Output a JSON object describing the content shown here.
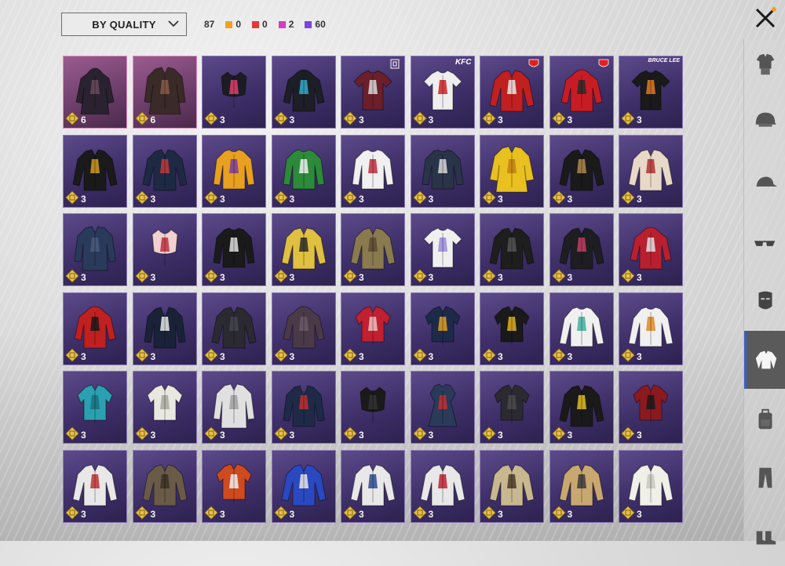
{
  "header": {
    "sort_label": "BY QUALITY",
    "total": "87",
    "stats": [
      {
        "color": "#f0a020",
        "value": "0"
      },
      {
        "color": "#e03a3a",
        "value": "0"
      },
      {
        "color": "#d33cc0",
        "value": "2"
      },
      {
        "color": "#7a44e0",
        "value": "60"
      }
    ]
  },
  "close_icon": "close-icon",
  "items": [
    {
      "count": "6",
      "tier": "pink",
      "art": "hooded-long-coat",
      "c1": "#2a2230",
      "c2": "#6a4a5a"
    },
    {
      "count": "6",
      "tier": "pink",
      "art": "trench-coat",
      "c1": "#3a2a28",
      "c2": "#8a5a4a"
    },
    {
      "count": "3",
      "tier": "purple",
      "art": "crop-top",
      "c1": "#1c1c24",
      "c2": "#e04070"
    },
    {
      "count": "3",
      "tier": "purple",
      "art": "hoodie",
      "c1": "#1e1e26",
      "c2": "#33aacc"
    },
    {
      "count": "3",
      "tier": "purple",
      "art": "tshirt",
      "c1": "#6a1f2a",
      "c2": "#d8d8d8",
      "brand_logo": "box"
    },
    {
      "count": "3",
      "tier": "purple",
      "art": "tshirt",
      "c1": "#eeeeee",
      "c2": "#d02020",
      "brand": "KFC"
    },
    {
      "count": "3",
      "tier": "purple",
      "art": "jacket",
      "c1": "#c02020",
      "c2": "#e8e8e8",
      "brand_logo": "shield"
    },
    {
      "count": "3",
      "tier": "purple",
      "art": "hoodie",
      "c1": "#c81c24",
      "c2": "#2a2a2a",
      "brand_logo": "shield"
    },
    {
      "count": "3",
      "tier": "purple",
      "art": "tshirt",
      "c1": "#1a1a1a",
      "c2": "#e07a20",
      "brand": "BRUCE LEE"
    },
    {
      "count": "3",
      "tier": "purple",
      "art": "jacket",
      "c1": "#1a1a1a",
      "c2": "#d09a20"
    },
    {
      "count": "3",
      "tier": "purple",
      "art": "jacket",
      "c1": "#1e2a44",
      "c2": "#c03a3a"
    },
    {
      "count": "3",
      "tier": "purple",
      "art": "sweater",
      "c1": "#e8a020",
      "c2": "#7a3aa0"
    },
    {
      "count": "3",
      "tier": "purple",
      "art": "sweater",
      "c1": "#2c8a3a",
      "c2": "#f0f0f0"
    },
    {
      "count": "3",
      "tier": "purple",
      "art": "sweater",
      "c1": "#f0f0f0",
      "c2": "#c02a3a"
    },
    {
      "count": "3",
      "tier": "purple",
      "art": "sweater",
      "c1": "#2a3448",
      "c2": "#d8d8d8"
    },
    {
      "count": "3",
      "tier": "purple",
      "art": "robe",
      "c1": "#e8c020",
      "c2": "#c08010"
    },
    {
      "count": "3",
      "tier": "purple",
      "art": "jacket",
      "c1": "#1a1a1a",
      "c2": "#b08a50"
    },
    {
      "count": "3",
      "tier": "purple",
      "art": "jacket",
      "c1": "#e8d8c8",
      "c2": "#b03030"
    },
    {
      "count": "3",
      "tier": "purple",
      "art": "coat",
      "c1": "#2a3a5a",
      "c2": "#4a5a7a"
    },
    {
      "count": "3",
      "tier": "purple",
      "art": "crop-top",
      "c1": "#f0d0d0",
      "c2": "#c03040"
    },
    {
      "count": "3",
      "tier": "purple",
      "art": "sweater",
      "c1": "#1a1a1a",
      "c2": "#e0e0e0"
    },
    {
      "count": "3",
      "tier": "purple",
      "art": "jacket",
      "c1": "#e0c040",
      "c2": "#2a2a2a"
    },
    {
      "count": "3",
      "tier": "purple",
      "art": "jacket",
      "c1": "#8a7a50",
      "c2": "#5a4a30"
    },
    {
      "count": "3",
      "tier": "purple",
      "art": "tshirt",
      "c1": "#f0f0f0",
      "c2": "#9a8ae0"
    },
    {
      "count": "3",
      "tier": "purple",
      "art": "jacket",
      "c1": "#1e1e1e",
      "c2": "#555555"
    },
    {
      "count": "3",
      "tier": "purple",
      "art": "jacket",
      "c1": "#1e1e22",
      "c2": "#c04060"
    },
    {
      "count": "3",
      "tier": "purple",
      "art": "hoodie",
      "c1": "#b82030",
      "c2": "#e0e0e0"
    },
    {
      "count": "3",
      "tier": "purple",
      "art": "hoodie",
      "c1": "#c02020",
      "c2": "#1a1a1a"
    },
    {
      "count": "3",
      "tier": "purple",
      "art": "blazer",
      "c1": "#1a2238",
      "c2": "#e8e8e8"
    },
    {
      "count": "3",
      "tier": "purple",
      "art": "jacket",
      "c1": "#2a2a30",
      "c2": "#444450"
    },
    {
      "count": "3",
      "tier": "purple",
      "art": "hoodie",
      "c1": "#4a3a48",
      "c2": "#6a5a68"
    },
    {
      "count": "3",
      "tier": "purple",
      "art": "shirt",
      "c1": "#c02030",
      "c2": "#f0c0c0"
    },
    {
      "count": "3",
      "tier": "purple",
      "art": "shirt",
      "c1": "#1e2a4a",
      "c2": "#e0a020"
    },
    {
      "count": "3",
      "tier": "purple",
      "art": "shirt",
      "c1": "#1a1a1a",
      "c2": "#e0b020"
    },
    {
      "count": "3",
      "tier": "purple",
      "art": "longsleeve",
      "c1": "#f0f0f0",
      "c2": "#40b0a0"
    },
    {
      "count": "3",
      "tier": "purple",
      "art": "longsleeve",
      "c1": "#f0f0f0",
      "c2": "#e08a20"
    },
    {
      "count": "3",
      "tier": "purple",
      "art": "shirt",
      "c1": "#2aa0b0",
      "c2": "#1a7080"
    },
    {
      "count": "3",
      "tier": "purple",
      "art": "shirt",
      "c1": "#e8e8e0",
      "c2": "#a8a8a0"
    },
    {
      "count": "3",
      "tier": "purple",
      "art": "coat",
      "c1": "#e0e0e0",
      "c2": "#a0a0a0"
    },
    {
      "count": "3",
      "tier": "purple",
      "art": "blazer",
      "c1": "#1e2a48",
      "c2": "#c03030"
    },
    {
      "count": "3",
      "tier": "purple",
      "art": "crop-top",
      "c1": "#1a1a1a",
      "c2": "#333333"
    },
    {
      "count": "3",
      "tier": "purple",
      "art": "dress",
      "c1": "#2a3a5a",
      "c2": "#c03030"
    },
    {
      "count": "3",
      "tier": "purple",
      "art": "shirt",
      "c1": "#2a2a30",
      "c2": "#4a4a50"
    },
    {
      "count": "3",
      "tier": "purple",
      "art": "jacket",
      "c1": "#1a1a1a",
      "c2": "#e0c020"
    },
    {
      "count": "3",
      "tier": "purple",
      "art": "shirt",
      "c1": "#8a1a20",
      "c2": "#1a1a1a"
    },
    {
      "count": "3",
      "tier": "purple",
      "art": "jacket",
      "c1": "#e8e8e8",
      "c2": "#c03030"
    },
    {
      "count": "3",
      "tier": "purple",
      "art": "jacket",
      "c1": "#6a5a48",
      "c2": "#3a3028"
    },
    {
      "count": "3",
      "tier": "purple",
      "art": "shirt",
      "c1": "#d04a20",
      "c2": "#f0f0f0"
    },
    {
      "count": "3",
      "tier": "purple",
      "art": "jacket",
      "c1": "#2a48c0",
      "c2": "#e8e8e8"
    },
    {
      "count": "3",
      "tier": "purple",
      "art": "jacket",
      "c1": "#e8e8e8",
      "c2": "#2a4a90"
    },
    {
      "count": "3",
      "tier": "purple",
      "art": "jacket",
      "c1": "#e8e8e8",
      "c2": "#c02030"
    },
    {
      "count": "3",
      "tier": "purple",
      "art": "jacket",
      "c1": "#c8b890",
      "c2": "#4a3a28"
    },
    {
      "count": "3",
      "tier": "purple",
      "art": "jacket",
      "c1": "#c8a870",
      "c2": "#3a3a3a"
    },
    {
      "count": "3",
      "tier": "purple",
      "art": "jacket",
      "c1": "#f0efe8",
      "c2": "#c8c8c0"
    }
  ],
  "sidebar": [
    {
      "name": "outfit-icon"
    },
    {
      "name": "helmet-icon"
    },
    {
      "name": "cap-icon"
    },
    {
      "name": "glasses-icon"
    },
    {
      "name": "mask-icon"
    },
    {
      "name": "shirt-icon",
      "active": true
    },
    {
      "name": "backpack-icon"
    },
    {
      "name": "pants-icon"
    },
    {
      "name": "shoes-icon"
    }
  ]
}
